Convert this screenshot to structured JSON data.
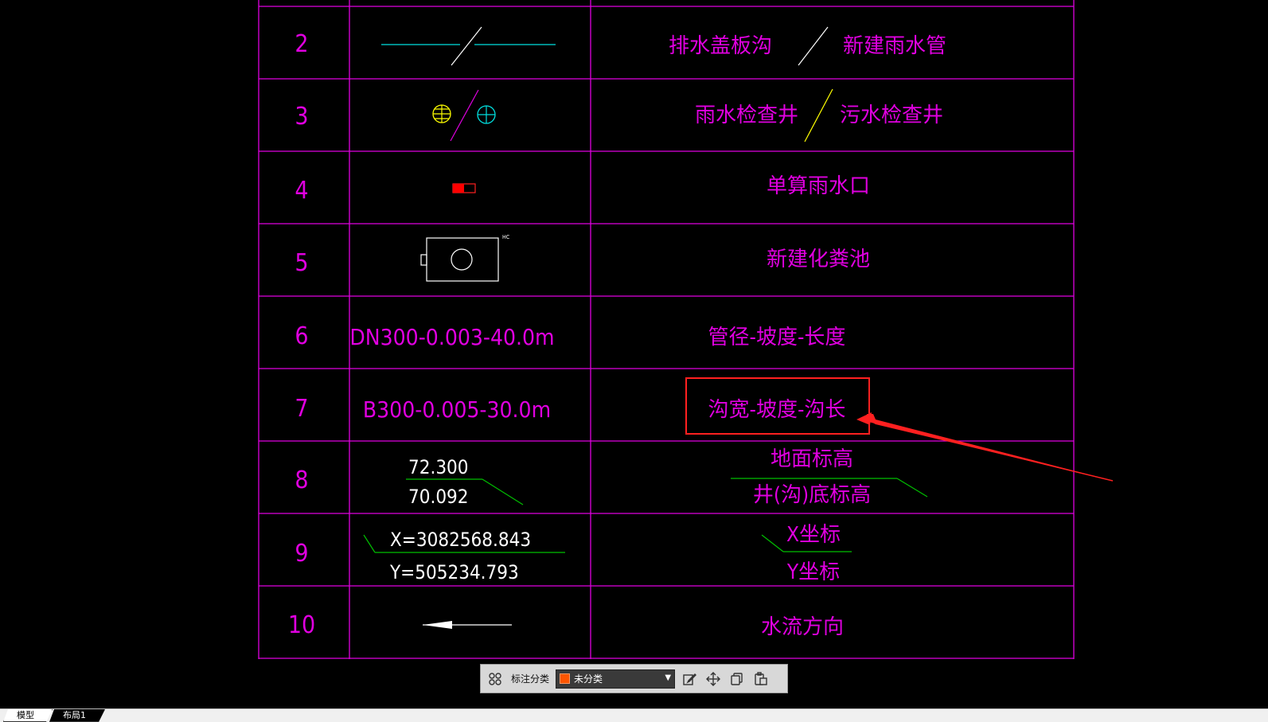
{
  "legend_rows": [
    {
      "num": "2",
      "desc_left": "排水盖板沟",
      "desc_right": "新建雨水管"
    },
    {
      "num": "3",
      "desc_left": "雨水检查井",
      "desc_right": "污水检查井"
    },
    {
      "num": "4",
      "desc": "单算雨水口"
    },
    {
      "num": "5",
      "symbol_tag": "HC",
      "desc": "新建化粪池"
    },
    {
      "num": "6",
      "symbol_text": "DN300-0.003-40.0m",
      "desc": "管径-坡度-长度"
    },
    {
      "num": "7",
      "symbol_text": "B300-0.005-30.0m",
      "desc": "沟宽-坡度-沟长"
    },
    {
      "num": "8",
      "symbol_top": "72.300",
      "symbol_bottom": "70.092",
      "desc_top": "地面标高",
      "desc_bottom": "井(沟)底标高"
    },
    {
      "num": "9",
      "symbol_top": "X=3082568.843",
      "symbol_bottom": "Y=505234.793",
      "desc_top": "X坐标",
      "desc_bottom": "Y坐标"
    },
    {
      "num": "10",
      "desc": "水流方向"
    }
  ],
  "toolbar": {
    "label": "标注分类",
    "selected_category": "未分类",
    "category_color": "#ff5500"
  },
  "tabs": [
    "模型",
    "布局1"
  ],
  "colors": {
    "table_lines": "#e000e0",
    "text": "#e000e0",
    "highlight_box": "#ff2020",
    "green": "#00c000",
    "cyan": "#00e0e0",
    "yellow": "#ffff00"
  }
}
